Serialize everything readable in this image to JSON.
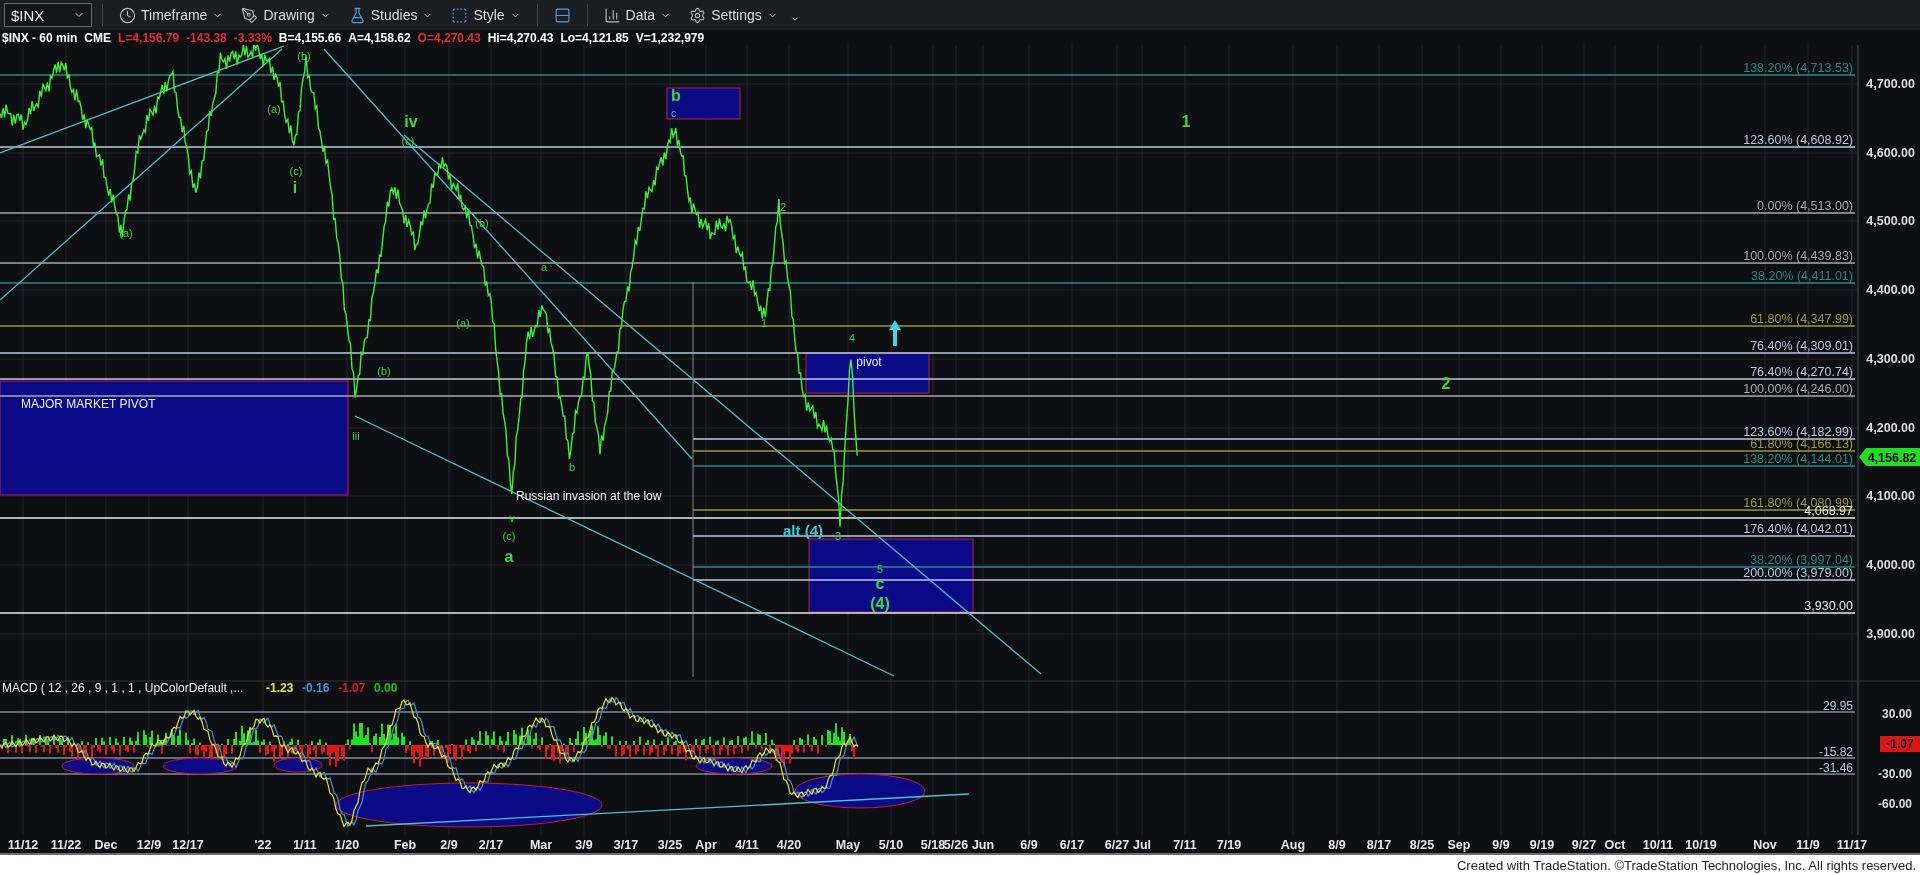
{
  "toolbar": {
    "symbol": "$INX",
    "items": [
      {
        "kind": "menu",
        "label": "Timeframe"
      },
      {
        "kind": "menu",
        "label": "Drawing"
      },
      {
        "kind": "menu",
        "label": "Studies"
      },
      {
        "kind": "menu",
        "label": "Style"
      },
      {
        "kind": "icon"
      },
      {
        "kind": "menu",
        "label": "Data"
      },
      {
        "kind": "menu",
        "label": "Settings"
      },
      {
        "kind": "caret"
      }
    ]
  },
  "quote": [
    {
      "text": "$INX - 60 min",
      "color": "#ffffff"
    },
    {
      "text": "CME",
      "color": "#ffffff"
    },
    {
      "text": "L=4,156.79",
      "color": "#e03030"
    },
    {
      "text": "-143.38",
      "color": "#e03030"
    },
    {
      "text": "-3.33%",
      "color": "#e03030"
    },
    {
      "text": "B=4,155.66",
      "color": "#ffffff"
    },
    {
      "text": "A=4,158.62",
      "color": "#ffffff"
    },
    {
      "text": "O=4,270.43",
      "color": "#e03030"
    },
    {
      "text": "Hi=4,270.43",
      "color": "#ffffff"
    },
    {
      "text": "Lo=4,121.85",
      "color": "#ffffff"
    },
    {
      "text": "V=1,232,979",
      "color": "#ffffff"
    }
  ],
  "fib_levels": [
    {
      "label": "138.20% (4,713.53)",
      "color": "#2a8a86"
    },
    {
      "label": "123.60% (4,608.92)",
      "color": "#b8c8e0"
    },
    {
      "label": "0.00% (4,513.00)",
      "color": "#a8a8a8"
    },
    {
      "label": "100.00% (4,439.83)",
      "color": "#a8a8a8"
    },
    {
      "label": "38.20% (4,411.01)",
      "color": "#2a8a86"
    },
    {
      "label": "61.80% (4,347.99)",
      "color": "#9a9a30"
    },
    {
      "label": "76.40% (4,309.01)",
      "color": "#b8c8e0"
    },
    {
      "label": "76.40% (4,270.74)",
      "color": "#b8c8e0"
    },
    {
      "label": "100.00% (4,246.00)",
      "color": "#a8a8a8"
    },
    {
      "label": "123.60% (4,182.99)",
      "color": "#b8c8e0"
    },
    {
      "label": "61.80% (4,166.13)",
      "color": "#9a9a30"
    },
    {
      "label": "138.20% (4,144.01)",
      "color": "#2a8a86"
    },
    {
      "label": "161.80% (4,080.99)",
      "color": "#9a9a30"
    },
    {
      "label": "4,068.97",
      "color": "#e8e8e8"
    },
    {
      "label": "176.40% (4,042.01)",
      "color": "#b8c8e0"
    },
    {
      "label": "38.20% (3,997.04)",
      "color": "#2a8a86"
    },
    {
      "label": "200.00% (3,979.00)",
      "color": "#b8c8e0"
    },
    {
      "label": "3,930.00",
      "color": "#e8e8e8"
    }
  ],
  "annotations": [
    {
      "text": "(b)",
      "kind": "wave"
    },
    {
      "text": "b",
      "kind": "wave_major"
    },
    {
      "text": "(a)",
      "kind": "wave"
    },
    {
      "text": "c",
      "kind": "wave"
    },
    {
      "text": "iv",
      "kind": "wave_major"
    },
    {
      "text": "1",
      "kind": "wave_major"
    },
    {
      "text": "(c)",
      "kind": "wave"
    },
    {
      "text": "(c)",
      "kind": "wave"
    },
    {
      "text": "i",
      "kind": "wave_major"
    },
    {
      "text": "2",
      "kind": "wave"
    },
    {
      "text": "(b)",
      "kind": "wave"
    },
    {
      "text": "(a)",
      "kind": "wave"
    },
    {
      "text": "a",
      "kind": "wave"
    },
    {
      "text": "(a)",
      "kind": "wave"
    },
    {
      "text": "1",
      "kind": "wave"
    },
    {
      "text": "4",
      "kind": "wave"
    },
    {
      "text": "pivot",
      "kind": "note"
    },
    {
      "text": "(b)",
      "kind": "wave"
    },
    {
      "text": "2",
      "kind": "wave_major"
    },
    {
      "text": "MAJOR MARKET PIVOT",
      "kind": "note"
    },
    {
      "text": "iii",
      "kind": "wave"
    },
    {
      "text": "b",
      "kind": "wave"
    },
    {
      "text": "Russian invasion at the low",
      "kind": "note"
    },
    {
      "text": "v",
      "kind": "wave"
    },
    {
      "text": "(c)",
      "kind": "wave"
    },
    {
      "text": "alt (4)",
      "kind": "alt"
    },
    {
      "text": "3",
      "kind": "wave"
    },
    {
      "text": "a",
      "kind": "wave_major"
    },
    {
      "text": "5",
      "kind": "wave"
    },
    {
      "text": "c",
      "kind": "wave_major"
    },
    {
      "text": "(4)",
      "kind": "wave_major"
    }
  ],
  "price_axis": {
    "ticks": [
      "4,700.00",
      "4,600.00",
      "4,500.00",
      "4,400.00",
      "4,300.00",
      "4,200.00",
      "4,100.00",
      "4,000.00",
      "3,900.00"
    ],
    "last_price": "4,156.82"
  },
  "macd": {
    "title": "MACD ( 12 , 26 , 9 , 1 , 1 , UpColorDefault ,...",
    "values": [
      {
        "text": "-1.23",
        "color": "#e8e820"
      },
      {
        "text": "-0.16",
        "color": "#4a90e0"
      },
      {
        "text": "-1.07",
        "color": "#e02020"
      },
      {
        "text": "0.00",
        "color": "#20c020"
      }
    ],
    "levels": [
      "29.95",
      "-15.82",
      "-31.46"
    ],
    "ticks": [
      "30.00",
      "-30.00",
      "-60.00"
    ],
    "last_value": "-1.07"
  },
  "date_axis": [
    "11/12",
    "11/22",
    "Dec",
    "12/9",
    "12/17",
    "'22",
    "1/11",
    "1/20",
    "Feb",
    "2/9",
    "2/17",
    "Mar",
    "3/9",
    "3/17",
    "3/25",
    "Apr",
    "4/11",
    "4/20",
    "May",
    "5/10",
    "5/18",
    "5/26",
    "Jun",
    "6/9",
    "6/17",
    "6/27",
    "Jul",
    "7/11",
    "7/19",
    "Aug",
    "8/9",
    "8/17",
    "8/25",
    "Sep",
    "9/9",
    "9/19",
    "9/27",
    "Oct",
    "10/11",
    "10/19",
    "Nov",
    "11/9",
    "11/17"
  ],
  "footer": "Created with TradeStation. ©TradeStation Technologies, Inc. All rights reserved."
}
